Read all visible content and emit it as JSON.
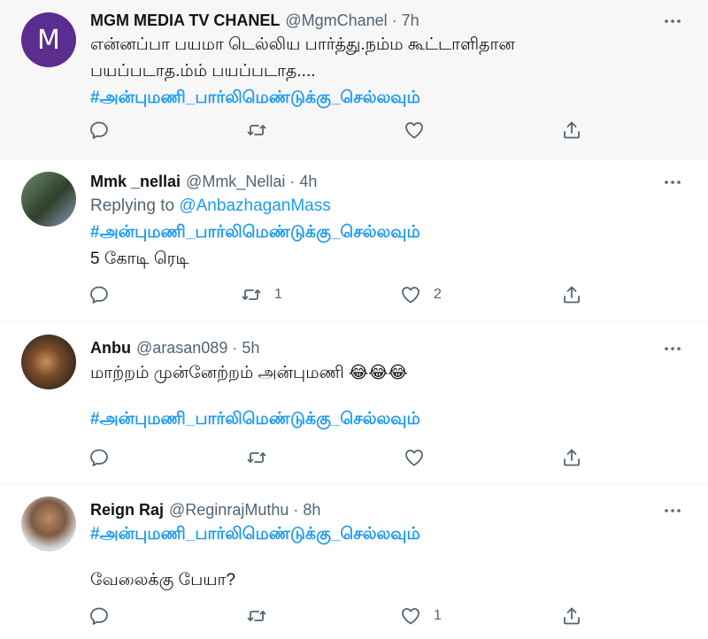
{
  "tweets": [
    {
      "avatar_letter": "M",
      "name": "MGM MEDIA TV CHANEL",
      "handle": "@MgmChanel",
      "time": "7h",
      "text_line1": "என்னப்பா பயமா டெல்லிய பார்த்து.நம்ம கூட்டாளிதான",
      "text_line2": "பயப்படாத.ம்ம் பயப்படாத....",
      "hashtag": "#அன்புமணி_பார்லிமெண்டுக்கு_செல்லவும்",
      "retweets": "",
      "likes": ""
    },
    {
      "name": "Mmk _nellai",
      "handle": "@Mmk_Nellai",
      "time": "4h",
      "replying_prefix": "Replying to",
      "replying_to": "@AnbazhaganMass",
      "hashtag": "#அன்புமணி_பார்லிமெண்டுக்கு_செல்லவும்",
      "text": "5 கோடி ரெடி",
      "retweets": "1",
      "likes": "2"
    },
    {
      "name": "Anbu",
      "handle": "@arasan089",
      "time": "5h",
      "text": "மாற்றம் முன்னேற்றம் அன்புமணி",
      "emoji": "😂😂😂",
      "hashtag": "#அன்புமணி_பார்லிமெண்டுக்கு_செல்லவும்",
      "retweets": "",
      "likes": ""
    },
    {
      "name": "Reign Raj",
      "handle": "@ReginrajMuthu",
      "time": "8h",
      "hashtag": "#அன்புமணி_பார்லிமெண்டுக்கு_செல்லவும்",
      "text": "வேலைக்கு பேயா?",
      "retweets": "",
      "likes": "1"
    }
  ],
  "separator": "·",
  "icons": [
    "reply-icon",
    "retweet-icon",
    "like-icon",
    "share-icon",
    "more-icon"
  ],
  "colors": {
    "link": "#1d9bf0",
    "muted": "#536471",
    "text": "#0f1419",
    "avatar_m": "#5b2d8e"
  }
}
